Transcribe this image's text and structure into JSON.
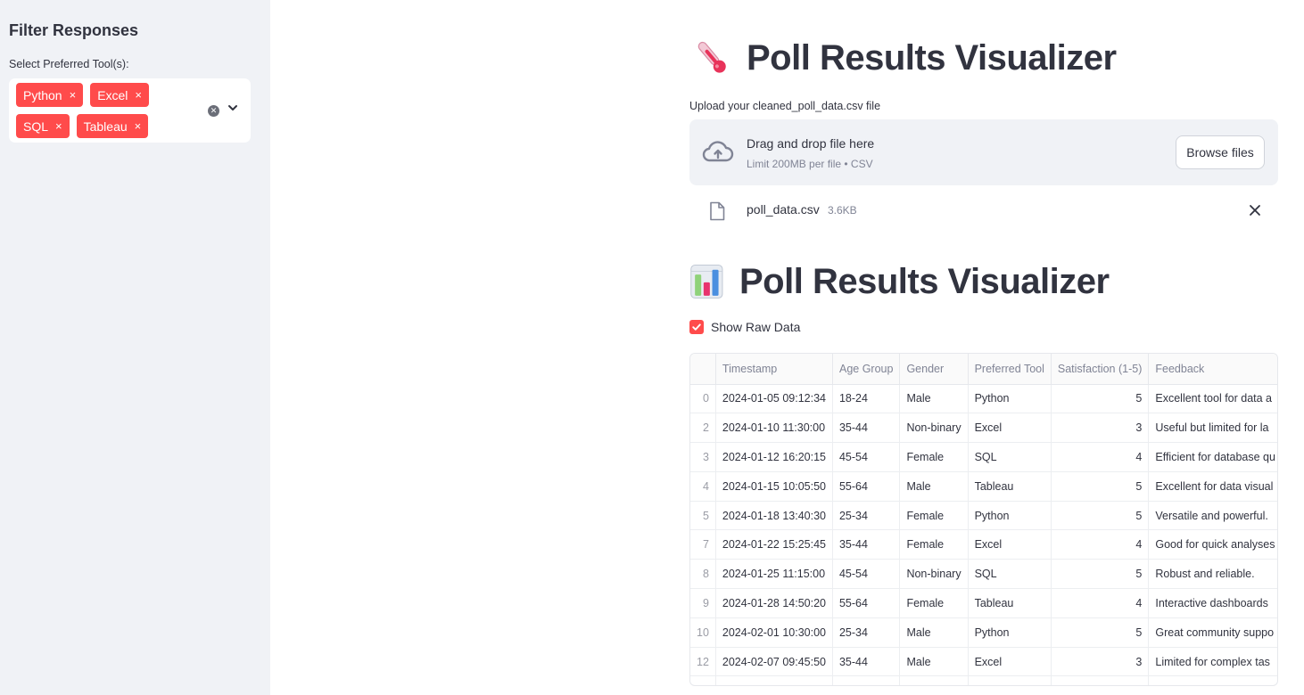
{
  "sidebar": {
    "title": "Filter Responses",
    "select_label": "Select Preferred Tool(s):",
    "selected_tags": [
      "Python",
      "Excel",
      "SQL",
      "Tableau"
    ],
    "tag_remove_glyph": "×"
  },
  "uploader": {
    "heading": "Poll Results Visualizer",
    "heading_icon": "thermometer-icon",
    "label": "Upload your cleaned_poll_data.csv file",
    "drop_title": "Drag and drop file here",
    "drop_limit": "Limit 200MB per file • CSV",
    "browse_label": "Browse files",
    "file_name": "poll_data.csv",
    "file_size": "3.6KB"
  },
  "results": {
    "heading": "Poll Results Visualizer",
    "heading_icon": "bar-chart-icon",
    "show_raw_label": "Show Raw Data",
    "show_raw_checked": true
  },
  "table": {
    "columns": [
      "",
      "Timestamp",
      "Age Group",
      "Gender",
      "Preferred Tool",
      "Satisfaction (1-5)",
      "Feedback"
    ],
    "rows": [
      [
        "0",
        "2024-01-05 09:12:34",
        "18-24",
        "Male",
        "Python",
        "5",
        "Excellent tool for data a"
      ],
      [
        "2",
        "2024-01-10 11:30:00",
        "35-44",
        "Non-binary",
        "Excel",
        "3",
        "Useful but limited for la"
      ],
      [
        "3",
        "2024-01-12 16:20:15",
        "45-54",
        "Female",
        "SQL",
        "4",
        "Efficient for database qu"
      ],
      [
        "4",
        "2024-01-15 10:05:50",
        "55-64",
        "Male",
        "Tableau",
        "5",
        "Excellent for data visual"
      ],
      [
        "5",
        "2024-01-18 13:40:30",
        "25-34",
        "Female",
        "Python",
        "5",
        "Versatile and powerful."
      ],
      [
        "7",
        "2024-01-22 15:25:45",
        "35-44",
        "Female",
        "Excel",
        "4",
        "Good for quick analyses"
      ],
      [
        "8",
        "2024-01-25 11:15:00",
        "45-54",
        "Non-binary",
        "SQL",
        "5",
        "Robust and reliable."
      ],
      [
        "9",
        "2024-01-28 14:50:20",
        "55-64",
        "Female",
        "Tableau",
        "4",
        "Interactive dashboards"
      ],
      [
        "10",
        "2024-02-01 10:30:00",
        "25-34",
        "Male",
        "Python",
        "5",
        "Great community suppo"
      ],
      [
        "12",
        "2024-02-07 09:45:50",
        "35-44",
        "Male",
        "Excel",
        "3",
        "Limited for complex tas"
      ]
    ]
  },
  "colors": {
    "accent": "#ff4b4b",
    "sidebar_bg": "#f0f2f6",
    "text": "#31333f",
    "muted": "#808495"
  }
}
